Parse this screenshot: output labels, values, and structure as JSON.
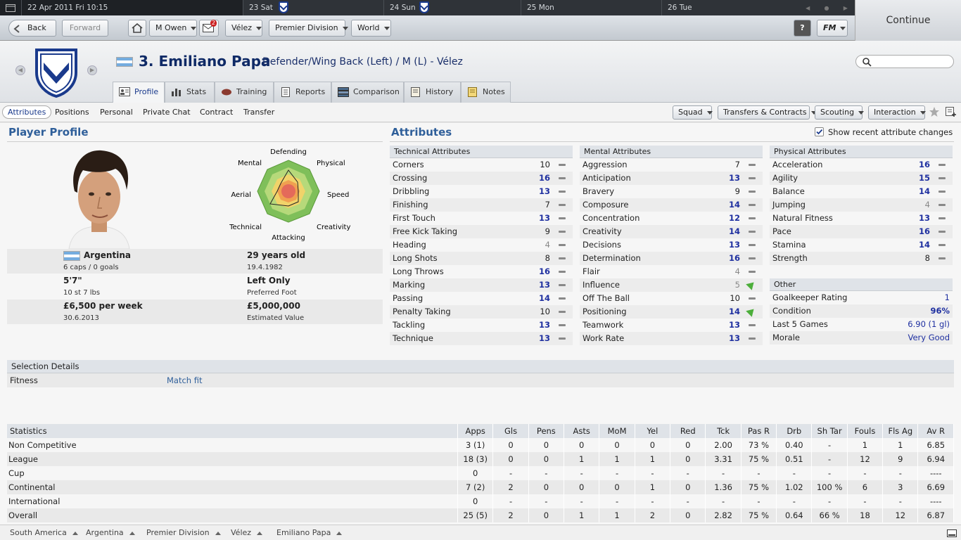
{
  "topbar": {
    "date": "22 Apr 2011 Fri 10:15",
    "days": [
      "23 Sat",
      "24 Sun",
      "25 Mon",
      "26 Tue"
    ],
    "continue_label": "Continue"
  },
  "toolbar": {
    "back": "Back",
    "forward": "Forward",
    "manager": "M Owen",
    "inbox_count": "2",
    "club": "Vélez",
    "league": "Premier Division",
    "world": "World",
    "help": "?",
    "fm": "FM"
  },
  "player": {
    "name": "3. Emiliano Papa",
    "role": "Defender/Wing Back (Left) / M (L) - Vélez"
  },
  "tabs": [
    "Profile",
    "Stats",
    "Training",
    "Reports",
    "Comparison",
    "History",
    "Notes"
  ],
  "subnav": [
    "Attributes",
    "Positions",
    "Personal",
    "Private Chat",
    "Contract",
    "Transfer"
  ],
  "actions": [
    "Squad",
    "Transfers & Contracts",
    "Scouting",
    "Interaction"
  ],
  "profile": {
    "title": "Player Profile",
    "radar": [
      "Defending",
      "Physical",
      "Speed",
      "Creativity",
      "Attacking",
      "Technical",
      "Aerial",
      "Mental"
    ],
    "nation": "Argentina",
    "caps": "6 caps / 0 goals",
    "age": "29 years old",
    "dob": "19.4.1982",
    "height": "5'7\"",
    "weight": "10 st 7 lbs",
    "foot": "Left Only",
    "foot_label": "Preferred Foot",
    "wage": "£6,500 per week",
    "contract": "30.6.2013",
    "value": "£5,000,000",
    "value_label": "Estimated Value"
  },
  "attributes": {
    "title": "Attributes",
    "show_changes": "Show recent attribute changes",
    "technical_title": "Technical Attributes",
    "technical": [
      [
        "Corners",
        "10",
        "mid",
        "dash"
      ],
      [
        "Crossing",
        "16",
        "hi",
        "dash"
      ],
      [
        "Dribbling",
        "13",
        "hi",
        "dash"
      ],
      [
        "Finishing",
        "7",
        "mid",
        "dash"
      ],
      [
        "First Touch",
        "13",
        "hi",
        "dash"
      ],
      [
        "Free Kick Taking",
        "9",
        "mid",
        "dash"
      ],
      [
        "Heading",
        "4",
        "lo",
        "dash"
      ],
      [
        "Long Shots",
        "8",
        "mid",
        "dash"
      ],
      [
        "Long Throws",
        "16",
        "hi",
        "dash"
      ],
      [
        "Marking",
        "13",
        "hi",
        "dash"
      ],
      [
        "Passing",
        "14",
        "hi",
        "dash"
      ],
      [
        "Penalty Taking",
        "10",
        "mid",
        "dash"
      ],
      [
        "Tackling",
        "13",
        "hi",
        "dash"
      ],
      [
        "Technique",
        "13",
        "hi",
        "dash"
      ]
    ],
    "mental_title": "Mental Attributes",
    "mental": [
      [
        "Aggression",
        "7",
        "mid",
        "dash"
      ],
      [
        "Anticipation",
        "13",
        "hi",
        "dash"
      ],
      [
        "Bravery",
        "9",
        "mid",
        "dash"
      ],
      [
        "Composure",
        "14",
        "hi",
        "dash"
      ],
      [
        "Concentration",
        "12",
        "hi",
        "dash"
      ],
      [
        "Creativity",
        "14",
        "hi",
        "dash"
      ],
      [
        "Decisions",
        "13",
        "hi",
        "dash"
      ],
      [
        "Determination",
        "16",
        "hi",
        "dash"
      ],
      [
        "Flair",
        "4",
        "lo",
        "dash"
      ],
      [
        "Influence",
        "5",
        "lo",
        "up"
      ],
      [
        "Off The Ball",
        "10",
        "mid",
        "dash"
      ],
      [
        "Positioning",
        "14",
        "hi",
        "up"
      ],
      [
        "Teamwork",
        "13",
        "hi",
        "dash"
      ],
      [
        "Work Rate",
        "13",
        "hi",
        "dash"
      ]
    ],
    "physical_title": "Physical Attributes",
    "physical": [
      [
        "Acceleration",
        "16",
        "hi",
        "dash"
      ],
      [
        "Agility",
        "15",
        "hi",
        "dash"
      ],
      [
        "Balance",
        "14",
        "hi",
        "dash"
      ],
      [
        "Jumping",
        "4",
        "lo",
        "dash"
      ],
      [
        "Natural Fitness",
        "13",
        "hi",
        "dash"
      ],
      [
        "Pace",
        "16",
        "hi",
        "dash"
      ],
      [
        "Stamina",
        "14",
        "hi",
        "dash"
      ],
      [
        "Strength",
        "8",
        "mid",
        "dash"
      ]
    ],
    "other_title": "Other",
    "other": [
      [
        "Goalkeeper Rating",
        "1"
      ],
      [
        "Condition",
        "96%"
      ],
      [
        "Last 5 Games",
        "6.90 (1 gl)"
      ],
      [
        "Morale",
        "Very Good"
      ]
    ]
  },
  "selection": {
    "title": "Selection Details",
    "label": "Fitness",
    "value": "Match fit"
  },
  "stats": {
    "headers": [
      "Statistics",
      "Apps",
      "Gls",
      "Pens",
      "Asts",
      "MoM",
      "Yel",
      "Red",
      "Tck",
      "Pas R",
      "Drb",
      "Sh Tar",
      "Fouls",
      "Fls Ag",
      "Av R"
    ],
    "rows": [
      [
        "Non Competitive",
        "3 (1)",
        "0",
        "0",
        "0",
        "0",
        "0",
        "0",
        "2.00",
        "73 %",
        "0.40",
        "-",
        "1",
        "1",
        "6.85"
      ],
      [
        "League",
        "18 (3)",
        "0",
        "0",
        "1",
        "1",
        "1",
        "0",
        "3.31",
        "75 %",
        "0.51",
        "-",
        "12",
        "9",
        "6.94"
      ],
      [
        "Cup",
        "0",
        "-",
        "-",
        "-",
        "-",
        "-",
        "-",
        "-",
        "-",
        "-",
        "-",
        "-",
        "-",
        "----"
      ],
      [
        "Continental",
        "7 (2)",
        "2",
        "0",
        "0",
        "0",
        "1",
        "0",
        "1.36",
        "75 %",
        "1.02",
        "100 %",
        "6",
        "3",
        "6.69"
      ],
      [
        "International",
        "0",
        "-",
        "-",
        "-",
        "-",
        "-",
        "-",
        "-",
        "-",
        "-",
        "-",
        "-",
        "-",
        "----"
      ],
      [
        "Overall",
        "25 (5)",
        "2",
        "0",
        "1",
        "1",
        "2",
        "0",
        "2.82",
        "75 %",
        "0.64",
        "66 %",
        "18",
        "12",
        "6.87"
      ]
    ]
  },
  "footer": [
    "South America",
    "Argentina",
    "Premier Division",
    "Vélez",
    "Emiliano Papa"
  ],
  "colors": {
    "accent": "#2f5f9a",
    "high_value": "#1e2fa0",
    "club_blue": "#1a3a8c"
  }
}
